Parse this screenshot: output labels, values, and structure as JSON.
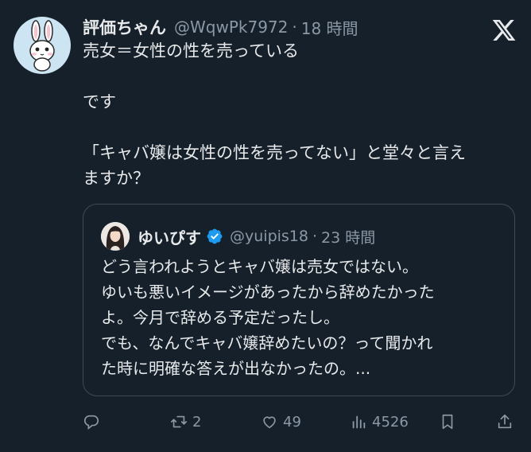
{
  "tweet": {
    "author_name": "評価ちゃん",
    "handle": "@WqwPk7972",
    "separator": "·",
    "time": "18 時間",
    "lines": [
      "売女＝女性の性を売っている",
      "です",
      "「キャバ嬢は女性の性を売ってない」と堂々と言え",
      "ますか？"
    ]
  },
  "quoted": {
    "author_name": "ゆいぴす",
    "handle": "@yuipis18",
    "separator": "·",
    "time": "23 時間",
    "lines": [
      "どう言われようとキャバ嬢は売女ではない。",
      "ゆいも悪いイメージがあったから辞めたかった",
      "よ。今月で辞める予定だったし。",
      "でも、なんでキャバ嬢辞めたいの？って聞かれ",
      "た時に明確な答えが出なかったの。..."
    ]
  },
  "actions": {
    "reply_count": "",
    "retweet_count": "2",
    "like_count": "49",
    "views_count": "4526"
  },
  "icons": {
    "platform": "x-logo-icon",
    "reply": "reply-icon",
    "retweet": "retweet-icon",
    "like": "heart-icon",
    "views": "views-icon",
    "bookmark": "bookmark-icon",
    "share": "share-icon",
    "verified": "verified-badge-icon"
  },
  "colors": {
    "background": "#15202b",
    "text": "#e7e9ea",
    "secondary": "#8b98a5",
    "verified": "#1d9bf0"
  }
}
